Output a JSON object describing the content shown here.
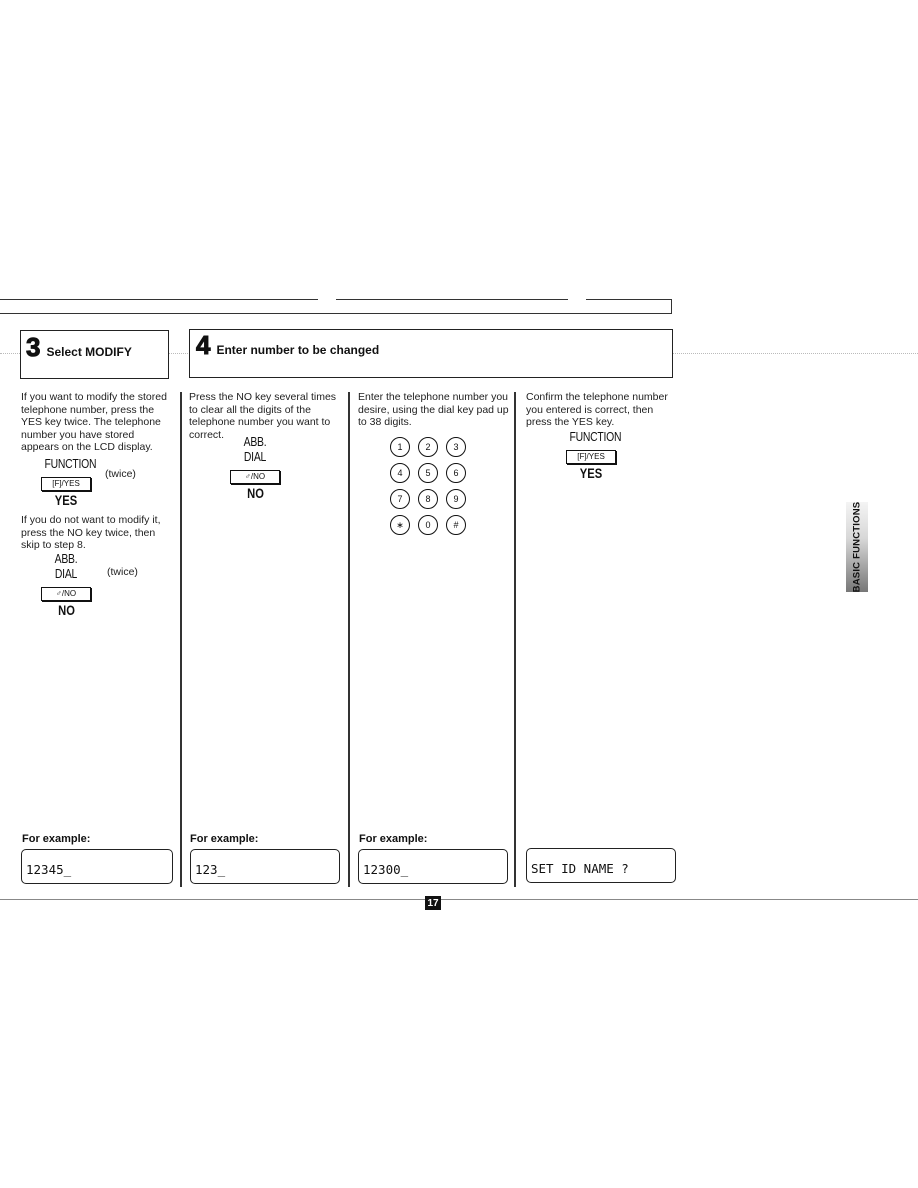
{
  "steps": [
    {
      "number": "3",
      "title": "Select MODIFY"
    },
    {
      "number": "4",
      "title": "Enter number to be changed"
    }
  ],
  "columns": {
    "col1": {
      "paragraph1": "If you want to modify the stored telephone number, press the YES key twice.  The telephone number you have stored appears on the LCD display.",
      "key1": {
        "label": "FUNCTION",
        "button": "[F]/YES",
        "result": "YES",
        "note": "(twice)"
      },
      "paragraph2": "If you do not want to modify it, press the NO key twice, then skip to step 8.",
      "key2": {
        "label": "ABB. DIAL",
        "button": "♂/NO",
        "result": "NO",
        "note": "(twice)"
      },
      "example_label": "For example:",
      "lcd": "12345_"
    },
    "col2": {
      "paragraph": "Press the NO key several times to clear all the digits of the telephone number you want to correct.",
      "key": {
        "label": "ABB. DIAL",
        "button": "♂/NO",
        "result": "NO"
      },
      "example_label": "For example:",
      "lcd": "123_"
    },
    "col3": {
      "paragraph": "Enter the telephone number you desire, using the dial key pad up to 38 digits.",
      "keypad": [
        "1",
        "2",
        "3",
        "4",
        "5",
        "6",
        "7",
        "8",
        "9",
        "∗",
        "0",
        "#"
      ],
      "example_label": "For example:",
      "lcd": "12300_"
    },
    "col4": {
      "paragraph": "Confirm the telephone number you entered is correct, then press the YES key.",
      "key": {
        "label": "FUNCTION",
        "button": "[F]/YES",
        "result": "YES"
      },
      "lcd": "SET ID NAME ?"
    }
  },
  "side_tab": "BASIC FUNCTIONS",
  "page_number": "17"
}
